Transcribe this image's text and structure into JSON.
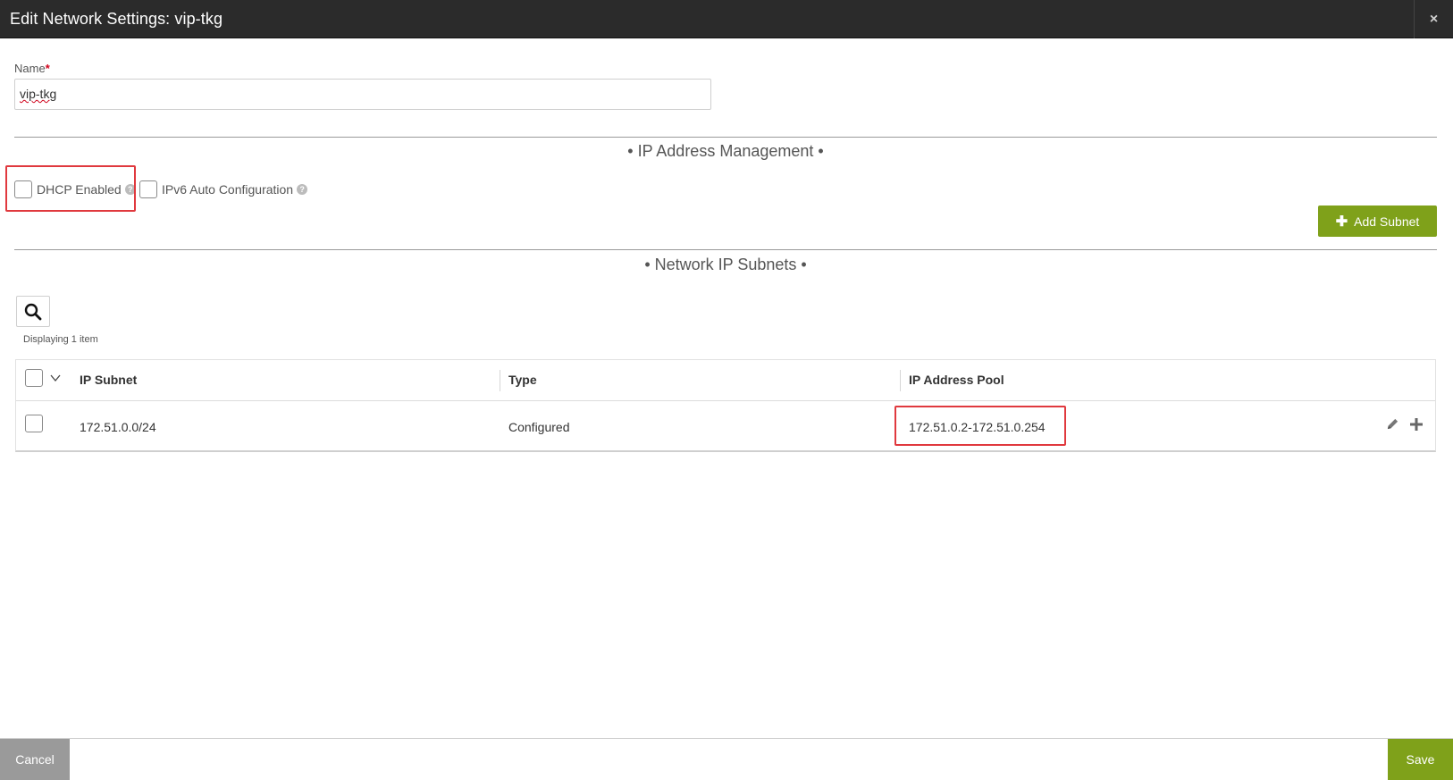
{
  "dialog": {
    "title": "Edit Network Settings: vip-tkg",
    "close_label": "×"
  },
  "name_field": {
    "label": "Name",
    "required_mark": "*",
    "value": "vip-tkg"
  },
  "ip_management": {
    "section_title": "• IP Address Management •",
    "dhcp_label": "DHCP Enabled",
    "ipv6_label": "IPv6 Auto Configuration",
    "help_glyph": "?",
    "add_subnet_label": "Add Subnet"
  },
  "subnets": {
    "section_title": "• Network IP Subnets •",
    "displaying_text": "Displaying 1 item",
    "columns": [
      "IP Subnet",
      "Type",
      "IP Address Pool"
    ],
    "rows": [
      {
        "ip_subnet": "172.51.0.0/24",
        "type": "Configured",
        "ip_pool": "172.51.0.2-172.51.0.254"
      }
    ]
  },
  "footer": {
    "cancel_label": "Cancel",
    "save_label": "Save"
  },
  "colors": {
    "titlebar_bg": "#2b2b2b",
    "accent_green": "#7fa11a",
    "highlight_red": "#e0393e",
    "cancel_gray": "#9a9a9a"
  }
}
